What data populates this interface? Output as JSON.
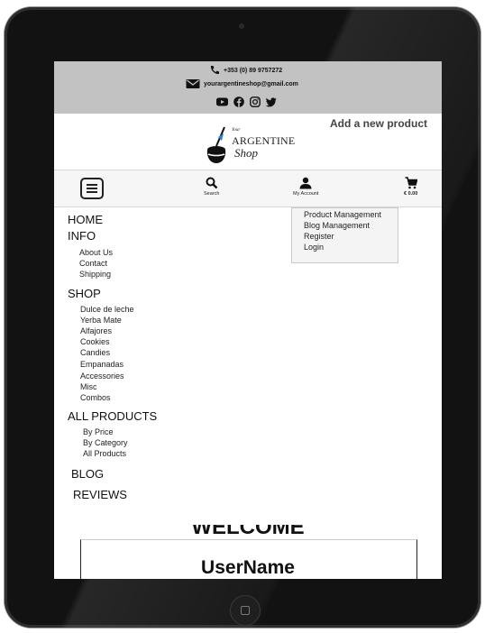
{
  "contact": {
    "phone": "+353 (0) 89 9757272",
    "email": "yourargentineshop@gmail.com",
    "social_icons": [
      "youtube-icon",
      "facebook-icon",
      "instagram-icon",
      "twitter-icon"
    ]
  },
  "header": {
    "add_product": "Add a new product",
    "logo_your": "Your",
    "logo_argentine": "ARGENTINE",
    "logo_shop": "Shop"
  },
  "navbar": {
    "search_label": "Search",
    "account_label": "My Account",
    "cart_total": "€ 0.00"
  },
  "account_menu": [
    "Product Management",
    "Blog Management",
    "Register",
    "Login"
  ],
  "menu": {
    "home": "HOME",
    "info": "INFO",
    "info_items": [
      "About Us",
      "Contact",
      "Shipping"
    ],
    "shop": "SHOP",
    "shop_items": [
      "Dulce de leche",
      "Yerba Mate",
      "Alfajores",
      "Cookies",
      "Candies",
      "Empanadas",
      "Accessories",
      "Misc",
      "Combos"
    ],
    "all_products": "ALL PRODUCTS",
    "all_products_items": [
      "By Price",
      "By Category",
      "All Products"
    ],
    "blog": "BLOG",
    "reviews": "REVIEWS"
  },
  "main": {
    "welcome": "WELCOME",
    "username": "UserName"
  },
  "colors": {
    "topbar": "#c2c2c2",
    "device_frame": "#121212",
    "navbar": "#f6f6f6"
  }
}
